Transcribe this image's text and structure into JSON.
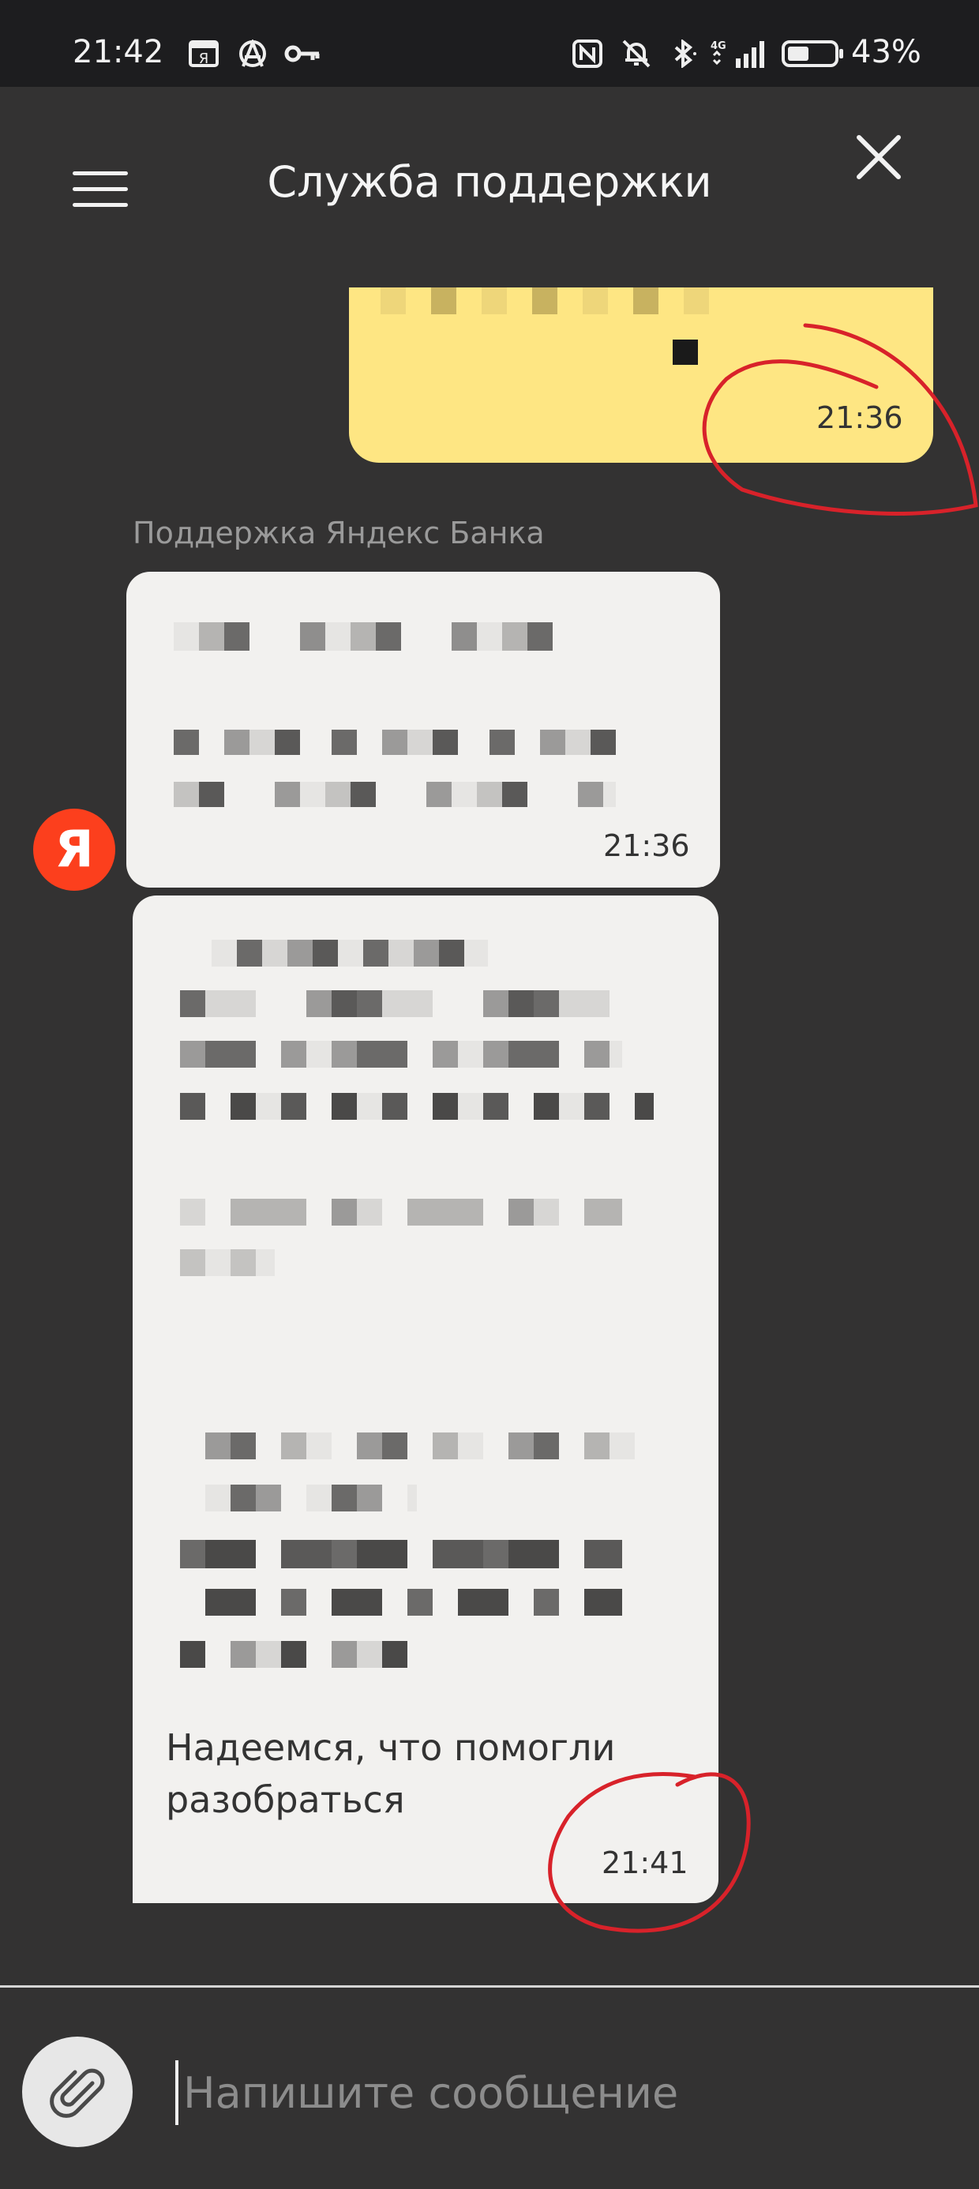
{
  "status_bar": {
    "time": "21:42",
    "battery_percent": "43%",
    "icons": [
      "yandex-notification-icon",
      "anarchy-icon",
      "key-icon",
      "nfc-icon",
      "mute-icon",
      "bluetooth-icon",
      "signal-4g-icon",
      "battery-icon"
    ]
  },
  "header": {
    "title": "Служба поддержки",
    "menu_icon": "hamburger-icon",
    "close_icon": "close-icon"
  },
  "chat": {
    "user_message": {
      "time": "21:36",
      "color": "#fee683"
    },
    "support_sender": "Поддержка Яндекс Банка",
    "support_avatar": "Я",
    "support_avatar_color": "#fc3f1d",
    "support_messages": [
      {
        "time": "21:36"
      },
      {
        "text": "Надеемся, что помогли разобраться",
        "time": "21:41"
      }
    ]
  },
  "composer": {
    "placeholder": "Напишите сообщение",
    "attach_icon": "paperclip-icon"
  }
}
